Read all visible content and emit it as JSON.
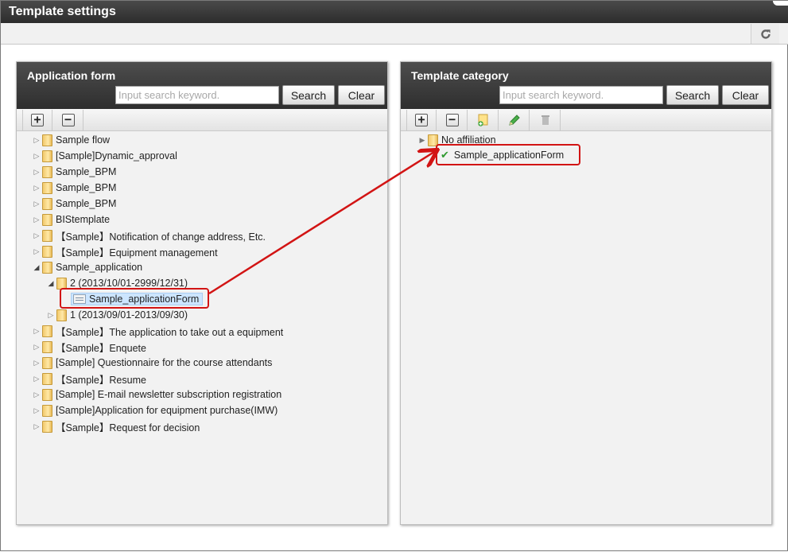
{
  "window": {
    "title": "Template settings"
  },
  "toolbar": {
    "reload_icon": "reload-icon"
  },
  "left_panel": {
    "title": "Application form",
    "search_placeholder": "Input search keyword.",
    "search_label": "Search",
    "clear_label": "Clear",
    "tree": [
      {
        "label": "Sample flow",
        "level": 0,
        "expanded": false,
        "icon": "folder"
      },
      {
        "label": "[Sample]Dynamic_approval",
        "level": 0,
        "expanded": false,
        "icon": "folder"
      },
      {
        "label": "Sample_BPM",
        "level": 0,
        "expanded": false,
        "icon": "folder"
      },
      {
        "label": "Sample_BPM",
        "level": 0,
        "expanded": false,
        "icon": "folder"
      },
      {
        "label": "Sample_BPM",
        "level": 0,
        "expanded": false,
        "icon": "folder"
      },
      {
        "label": "BIStemplate",
        "level": 0,
        "expanded": false,
        "icon": "folder"
      },
      {
        "label": "【Sample】Notification of change address, Etc.",
        "level": 0,
        "expanded": false,
        "icon": "folder"
      },
      {
        "label": "【Sample】Equipment management",
        "level": 0,
        "expanded": false,
        "icon": "folder"
      },
      {
        "label": "Sample_application",
        "level": 0,
        "expanded": true,
        "icon": "folder"
      },
      {
        "label": "2 (2013/10/01-2999/12/31)",
        "level": 1,
        "expanded": true,
        "icon": "folder"
      },
      {
        "label": "Sample_applicationForm",
        "level": 2,
        "expanded": false,
        "icon": "form",
        "selected": true
      },
      {
        "label": "1 (2013/09/01-2013/09/30)",
        "level": 1,
        "expanded": false,
        "icon": "folder"
      },
      {
        "label": "【Sample】The application to take out a equipment",
        "level": 0,
        "expanded": false,
        "icon": "folder"
      },
      {
        "label": "【Sample】Enquete",
        "level": 0,
        "expanded": false,
        "icon": "folder"
      },
      {
        "label": "[Sample] Questionnaire for the course attendants",
        "level": 0,
        "expanded": false,
        "icon": "folder"
      },
      {
        "label": "【Sample】Resume",
        "level": 0,
        "expanded": false,
        "icon": "folder"
      },
      {
        "label": "[Sample] E-mail newsletter subscription registration",
        "level": 0,
        "expanded": false,
        "icon": "folder"
      },
      {
        "label": "[Sample]Application for equipment purchase(IMW)",
        "level": 0,
        "expanded": false,
        "icon": "folder"
      },
      {
        "label": "【Sample】Request for decision",
        "level": 0,
        "expanded": false,
        "icon": "folder"
      }
    ]
  },
  "right_panel": {
    "title": "Template category",
    "search_placeholder": "Input search keyword.",
    "search_label": "Search",
    "clear_label": "Clear",
    "tree": [
      {
        "label": "No affiliation",
        "icon": "folder"
      },
      {
        "label": "Sample_applicationForm",
        "icon": "check"
      }
    ]
  },
  "colors": {
    "annotation": "#d21414",
    "header": "#3a3a3a",
    "selection": "#cce5ff"
  }
}
